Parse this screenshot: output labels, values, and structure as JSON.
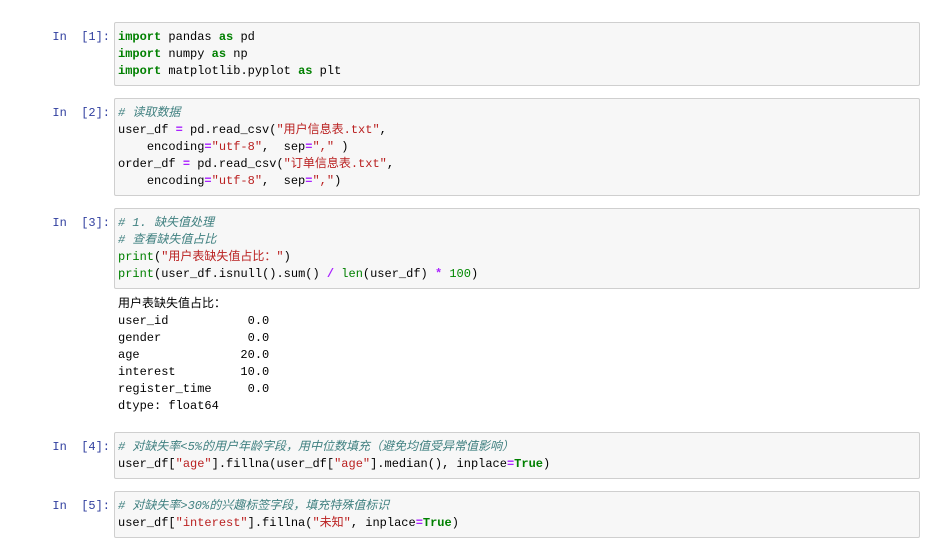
{
  "theme": {
    "prompt": "#303F9F",
    "keyword": "#008000",
    "builtin": "#008000",
    "comment": "#408080",
    "string": "#BA2121",
    "number": "#008800",
    "operator": "#AA22FF",
    "editor_background": "#F7F7F7",
    "editor_border": "#CFCFCF"
  },
  "cells": [
    {
      "prompt": "In  [1]:",
      "input": [
        "import pandas as pd",
        "import numpy as np",
        "import matplotlib.pyplot as plt"
      ]
    },
    {
      "prompt": "In  [2]:",
      "input": [
        "# 读取数据",
        "user_df = pd.read_csv(\"用户信息表.txt\",",
        "    encoding=\"utf-8\",  sep=\",\" )",
        "order_df = pd.read_csv(\"订单信息表.txt\",",
        "    encoding=\"utf-8\",  sep=\",\")"
      ]
    },
    {
      "prompt": "In  [3]:",
      "input": [
        "# 1. 缺失值处理",
        "# 查看缺失值占比",
        "print(\"用户表缺失值占比：\")",
        "print(user_df.isnull().sum() / len(user_df) * 100)"
      ],
      "output": [
        "用户表缺失值占比：",
        "user_id           0.0",
        "gender            0.0",
        "age              20.0",
        "interest         10.0",
        "register_time     0.0",
        "dtype: float64"
      ]
    },
    {
      "prompt": "In  [4]:",
      "input": [
        "# 对缺失率<5%的用户年龄字段，用中位数填充（避免均值受异常值影响）",
        "user_df[\"age\"].fillna(user_df[\"age\"].median(), inplace=True)"
      ]
    },
    {
      "prompt": "In  [5]:",
      "input": [
        "# 对缺失率>30%的兴趣标签字段，填充特殊值标识",
        "user_df[\"interest\"].fillna(\"未知\", inplace=True)"
      ]
    }
  ]
}
